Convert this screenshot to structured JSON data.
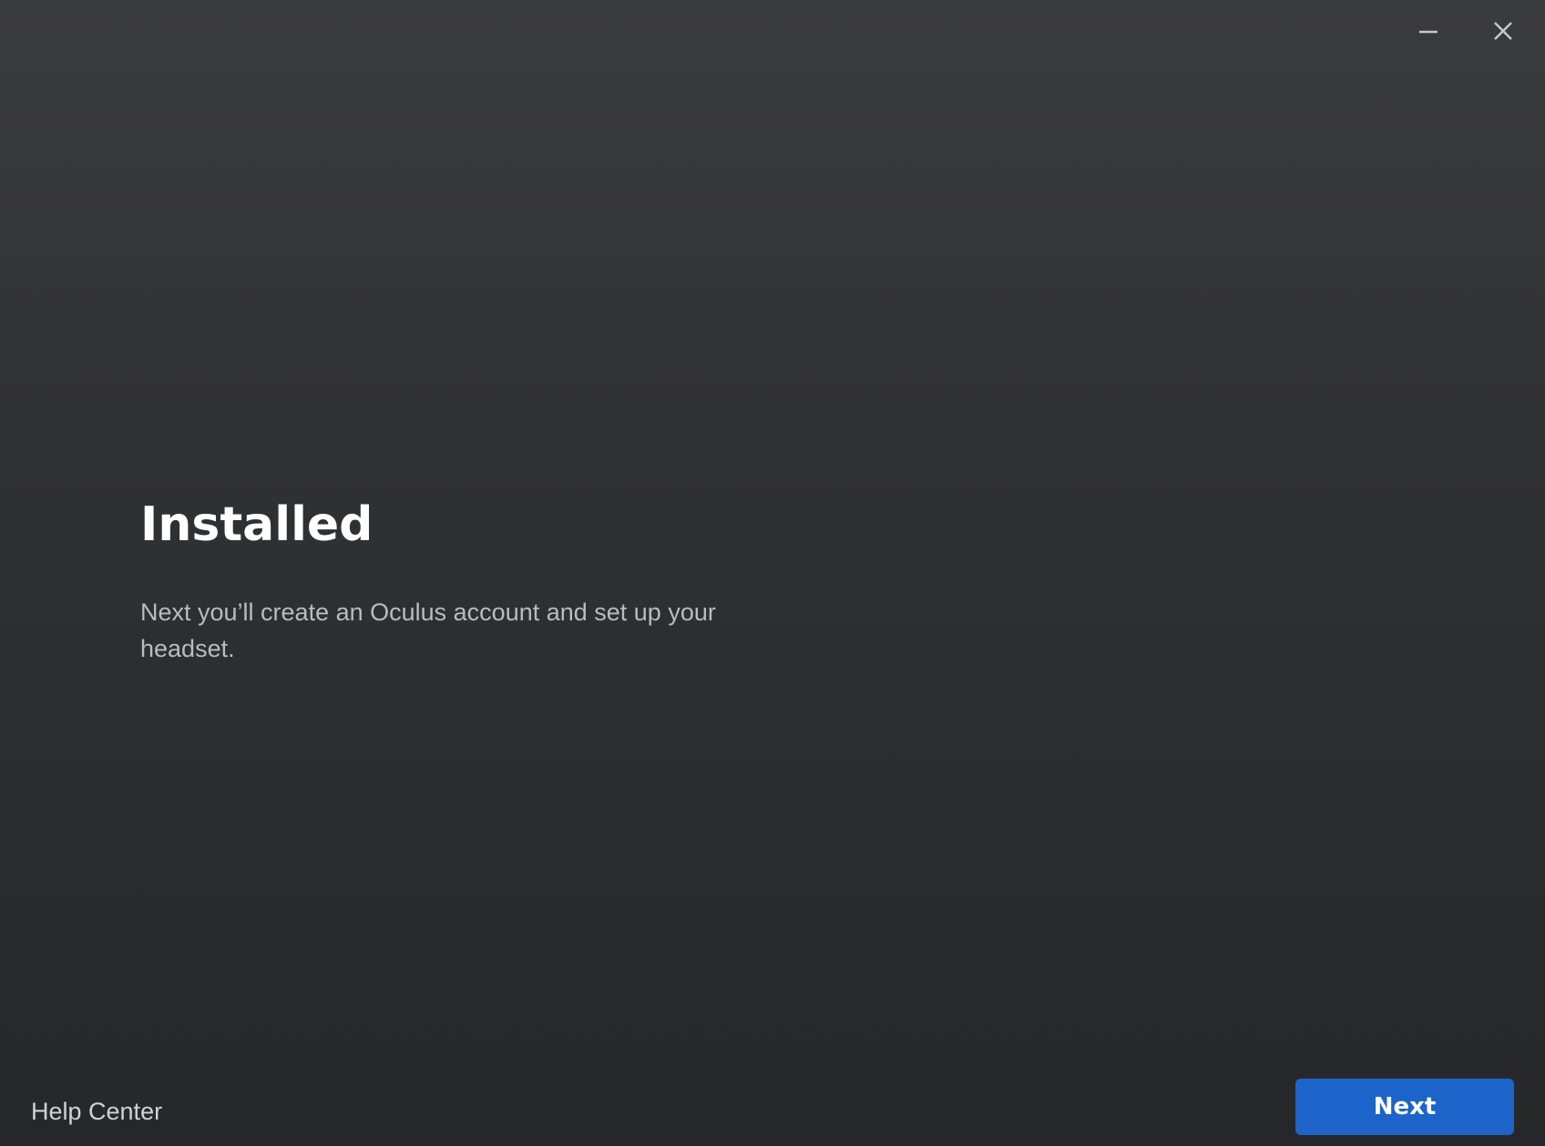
{
  "window": {
    "minimize_icon": "minimize-icon",
    "close_icon": "close-icon",
    "icon_color": "#c7c9cc"
  },
  "main": {
    "title": "Installed",
    "subtitle": "Next you’ll create an Oculus account and set up your headset."
  },
  "footer": {
    "help_label": "Help Center",
    "next_label": "Next"
  },
  "colors": {
    "accent": "#1c64c9",
    "background_top": "#3a3b3e",
    "background_bottom": "#25272a"
  }
}
